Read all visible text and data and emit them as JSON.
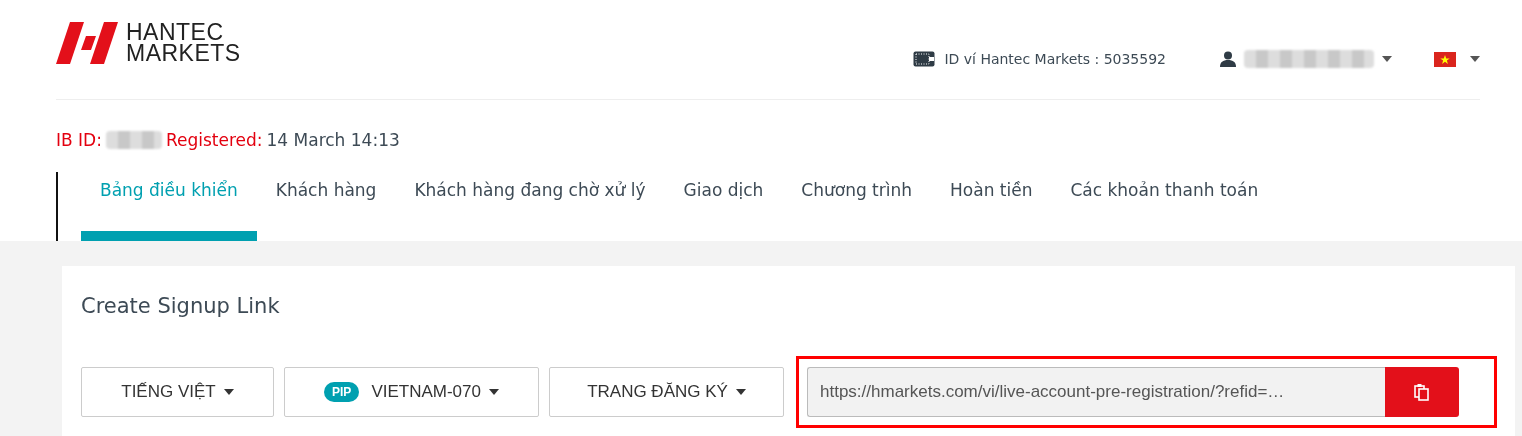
{
  "logo": {
    "line_1": "HANTEC",
    "line_2": "MARKETS"
  },
  "header": {
    "wallet_label": "ID ví Hantec Markets : 5035592",
    "user": {
      "name_hidden": true
    }
  },
  "ib_info": {
    "id_label": "IB ID:",
    "id_hidden": true,
    "registered_label": "Registered:",
    "registered_value": "14 March 14:13"
  },
  "tabs": [
    {
      "label": "Bảng điều khiển",
      "selected": true
    },
    {
      "label": "Khách hàng",
      "selected": false
    },
    {
      "label": "Khách hàng đang chờ xử lý",
      "selected": false
    },
    {
      "label": "Giao dịch",
      "selected": false
    },
    {
      "label": "Chương trình",
      "selected": false
    },
    {
      "label": "Hoàn tiền",
      "selected": false
    },
    {
      "label": "Các khoản thanh toán",
      "selected": false
    }
  ],
  "card": {
    "title": "Create Signup Link",
    "dropdowns": [
      {
        "value": "TIẾNG VIỆT"
      },
      {
        "badge": "PIP",
        "value": "VIETNAM-070"
      },
      {
        "value": "TRANG ĐĂNG KÝ"
      }
    ],
    "link": {
      "value": "https://hmarkets.com/vi/live-account-pre-registration/?refid=…",
      "highlighted": true
    }
  }
}
